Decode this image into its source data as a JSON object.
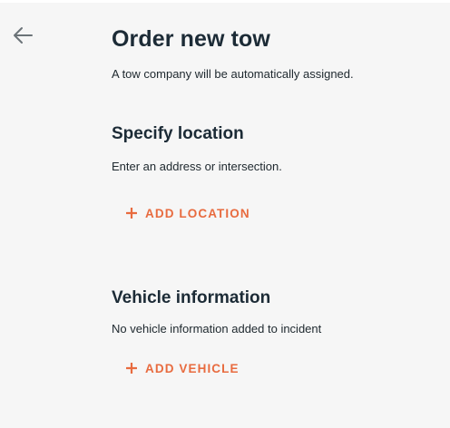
{
  "header": {
    "title": "Order new tow",
    "subtitle": "A tow company will be automatically assigned."
  },
  "location_section": {
    "title": "Specify location",
    "description": "Enter an address or intersection.",
    "button_label": "ADD LOCATION"
  },
  "vehicle_section": {
    "title": "Vehicle information",
    "description": "No vehicle information added to incident",
    "button_label": "ADD VEHICLE"
  },
  "icons": {
    "back": "arrow-left-icon",
    "add": "plus-icon"
  },
  "colors": {
    "background": "#f6f6f6",
    "accent": "#e86b3f",
    "heading": "#1c2b36",
    "icon_gray": "#6b7378"
  }
}
